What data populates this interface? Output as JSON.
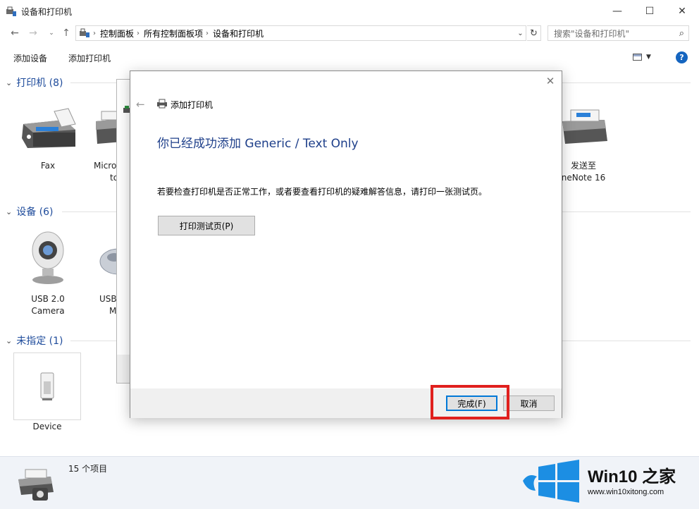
{
  "window": {
    "title": "设备和打印机"
  },
  "address": {
    "crumbs": [
      "控制面板",
      "所有控制面板项",
      "设备和打印机"
    ]
  },
  "search": {
    "placeholder": "搜索\"设备和打印机\""
  },
  "commands": {
    "add_device": "添加设备",
    "add_printer": "添加打印机"
  },
  "groups": {
    "printers": {
      "label": "打印机 (8)",
      "items": [
        {
          "name": "Fax",
          "line2": ""
        },
        {
          "name": "Micro",
          "line2": "to"
        },
        {
          "name": "发送至",
          "line2": "neNote 16"
        }
      ]
    },
    "devices": {
      "label": "设备 (6)",
      "items": [
        {
          "name": "USB 2.0",
          "line2": "Camera"
        },
        {
          "name": "USB",
          "line2": "M"
        }
      ]
    },
    "unspecified": {
      "label": "未指定 (1)",
      "items": [
        {
          "name": "Device",
          "line2": ""
        }
      ]
    }
  },
  "status": {
    "count": "15 个项目"
  },
  "dialog": {
    "title": "添加打印机",
    "heading": "你已经成功添加 Generic / Text Only",
    "description": "若要检查打印机是否正常工作，或者要查看打印机的疑难解答信息，请打印一张测试页。",
    "test_button": "打印测试页(P)",
    "finish_button": "完成(F)",
    "cancel_button": "取消"
  },
  "watermark": {
    "brand": "Win10 之家",
    "url": "www.win10xitong.com"
  },
  "colors": {
    "accent": "#1e4b9b",
    "highlight": "#e0201e",
    "win_logo": "#1c8ee3"
  }
}
